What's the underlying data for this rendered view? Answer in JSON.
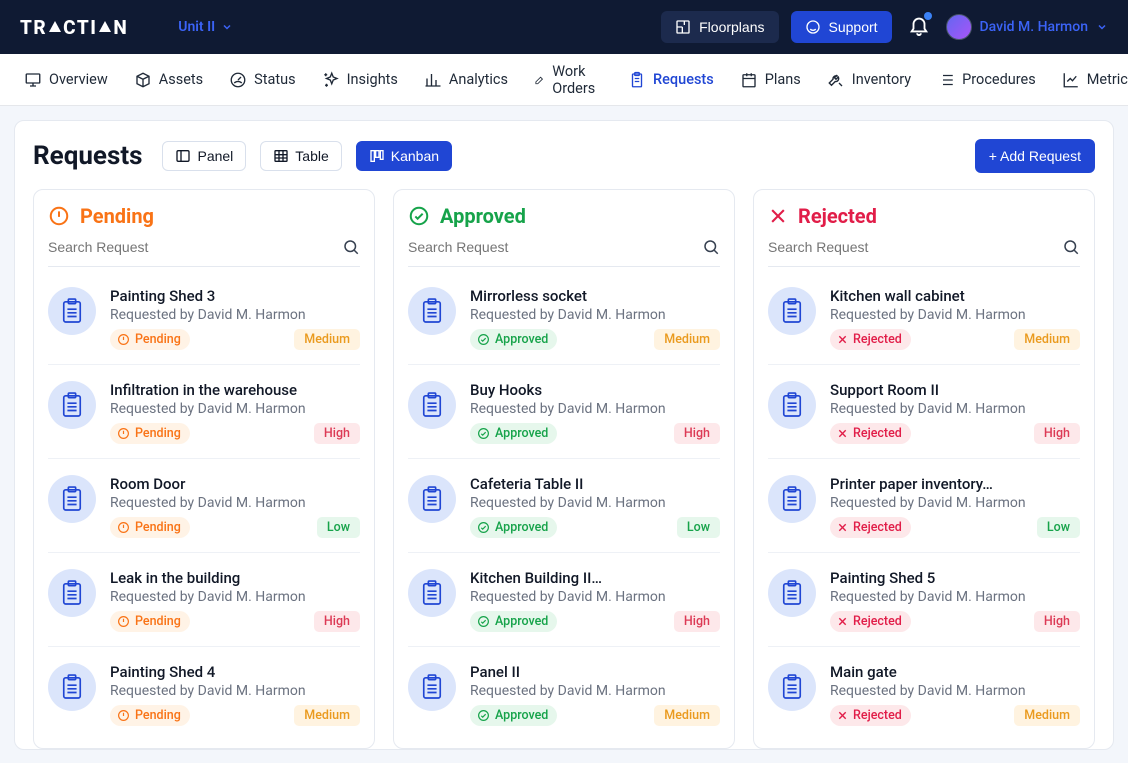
{
  "brand": "TRACTIAN",
  "unit_label": "Unit II",
  "topbar": {
    "floorplans": "Floorplans",
    "support": "Support",
    "user": "David M. Harmon"
  },
  "nav": [
    {
      "label": "Overview",
      "icon": "monitor"
    },
    {
      "label": "Assets",
      "icon": "cube"
    },
    {
      "label": "Status",
      "icon": "gauge"
    },
    {
      "label": "Insights",
      "icon": "spark"
    },
    {
      "label": "Analytics",
      "icon": "bars"
    },
    {
      "label": "Work Orders",
      "icon": "edit"
    },
    {
      "label": "Requests",
      "icon": "clipboard",
      "active": true
    },
    {
      "label": "Plans",
      "icon": "calendar"
    },
    {
      "label": "Inventory",
      "icon": "tools"
    },
    {
      "label": "Procedures",
      "icon": "list"
    },
    {
      "label": "Metrics",
      "icon": "chart"
    }
  ],
  "page": {
    "title": "Requests",
    "views": {
      "panel": "Panel",
      "table": "Table",
      "kanban": "Kanban"
    },
    "add_label": "+ Add Request"
  },
  "columns": {
    "pending": {
      "title": "Pending",
      "search": "Search Request"
    },
    "approved": {
      "title": "Approved",
      "search": "Search Request"
    },
    "rejected": {
      "title": "Rejected",
      "search": "Search Request"
    }
  },
  "status_labels": {
    "pending": "Pending",
    "approved": "Approved",
    "rejected": "Rejected"
  },
  "subtitle_prefix": "Requested by ",
  "items": {
    "pending": [
      {
        "title": "Painting Shed 3",
        "by": "David M. Harmon",
        "status": "pending",
        "priority": "Medium"
      },
      {
        "title": "Infiltration in the warehouse",
        "by": "David M. Harmon",
        "status": "pending",
        "priority": "High"
      },
      {
        "title": "Room Door",
        "by": "David M. Harmon",
        "status": "pending",
        "priority": "Low"
      },
      {
        "title": "Leak in the building",
        "by": "David M. Harmon",
        "status": "pending",
        "priority": "High"
      },
      {
        "title": "Painting Shed 4",
        "by": "David M. Harmon",
        "status": "pending",
        "priority": "Medium"
      }
    ],
    "approved": [
      {
        "title": "Mirrorless socket",
        "by": "David M. Harmon",
        "status": "approved",
        "priority": "Medium"
      },
      {
        "title": "Buy Hooks",
        "by": "David M. Harmon",
        "status": "approved",
        "priority": "High"
      },
      {
        "title": "Cafeteria Table II",
        "by": "David M. Harmon",
        "status": "approved",
        "priority": "Low"
      },
      {
        "title": "Kitchen Building II…",
        "by": "David M. Harmon",
        "status": "approved",
        "priority": "High"
      },
      {
        "title": "Panel II",
        "by": "David M. Harmon",
        "status": "approved",
        "priority": "Medium"
      }
    ],
    "rejected": [
      {
        "title": "Kitchen wall cabinet",
        "by": "David M. Harmon",
        "status": "rejected",
        "priority": "Medium"
      },
      {
        "title": "Support Room II",
        "by": "David M. Harmon",
        "status": "rejected",
        "priority": "High"
      },
      {
        "title": "Printer paper inventory…",
        "by": "David M. Harmon",
        "status": "rejected",
        "priority": "Low"
      },
      {
        "title": "Painting Shed 5",
        "by": "David M. Harmon",
        "status": "rejected",
        "priority": "High"
      },
      {
        "title": "Main gate",
        "by": "David M. Harmon",
        "status": "rejected",
        "priority": "Medium"
      }
    ]
  }
}
